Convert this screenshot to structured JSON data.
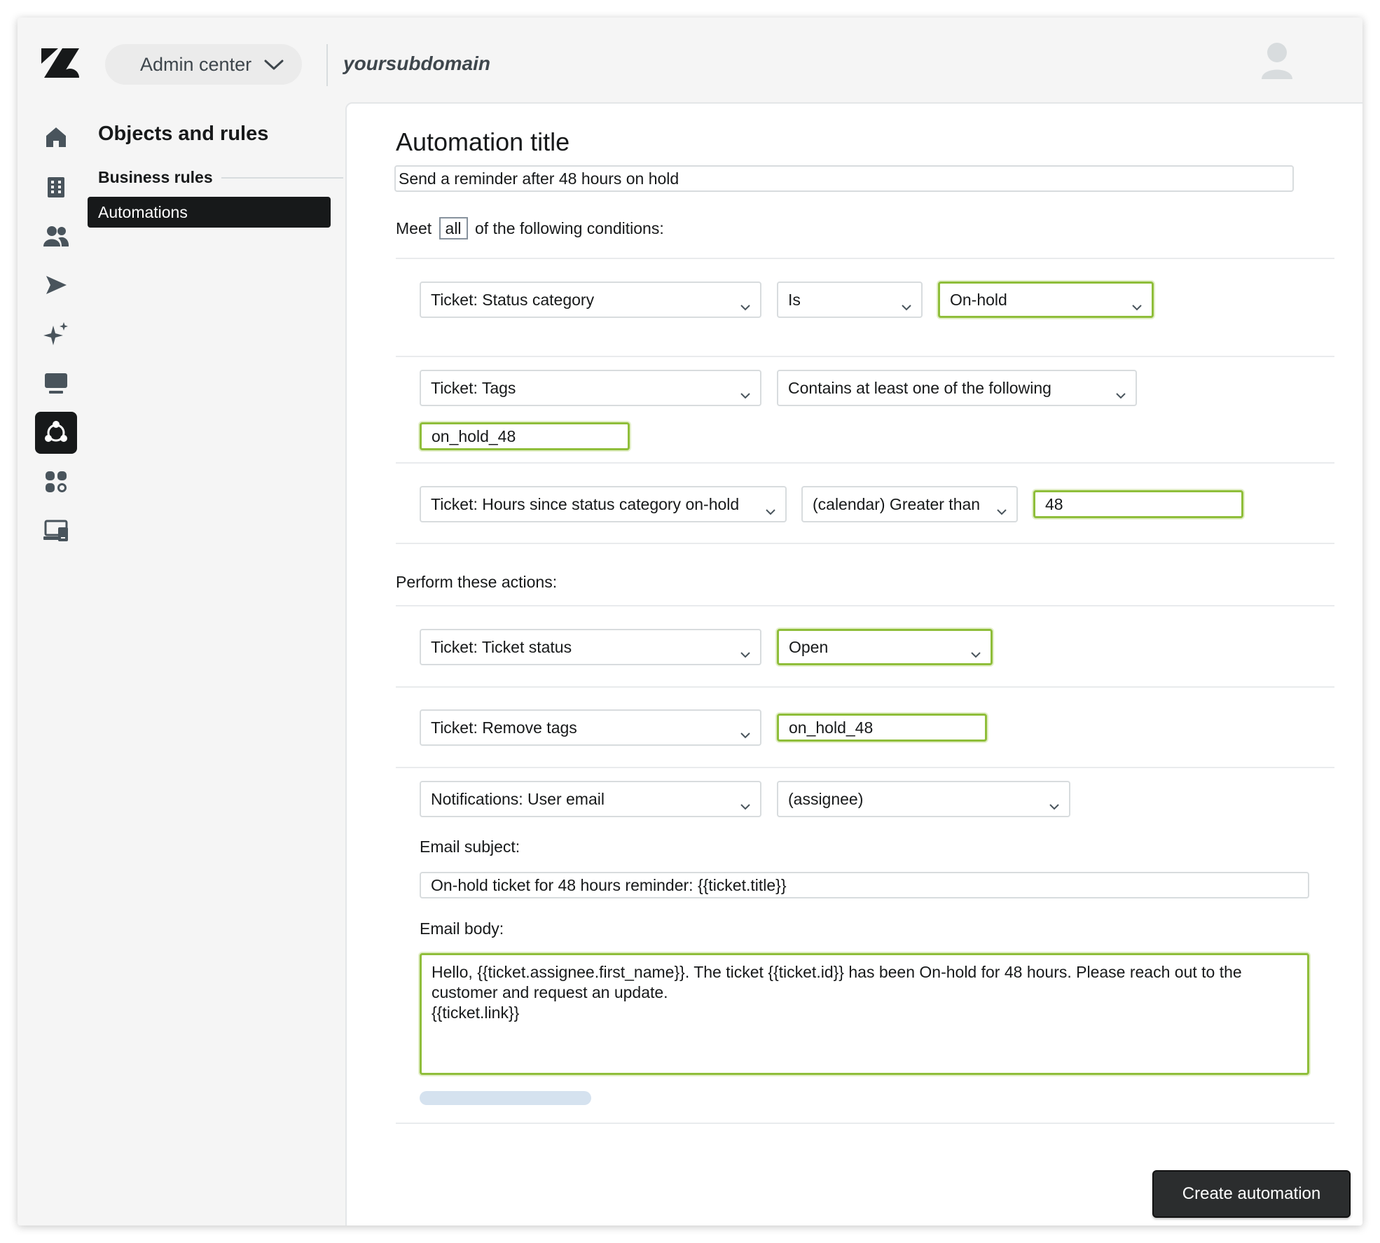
{
  "header": {
    "product_switcher_label": "Admin center",
    "subdomain": "yoursubdomain"
  },
  "icons": {
    "logo": "zendesk-logo-icon",
    "avatar": "user-avatar-icon",
    "nav": [
      "home-icon",
      "building-icon",
      "people-icon",
      "send-icon",
      "sparkle-icon",
      "monitor-icon",
      "objects-rules-icon",
      "apps-icon",
      "devices-icon"
    ]
  },
  "secondary_nav": {
    "title": "Objects and rules",
    "group_label": "Business rules",
    "selected_item": "Automations"
  },
  "form": {
    "title_label": "Automation title",
    "title_value": "Send a reminder after 48 hours on hold",
    "conditions_prefix": "Meet",
    "conditions_match": "all",
    "conditions_suffix": "of the following conditions:",
    "conditions": [
      {
        "field": "Ticket: Status category",
        "operator": "Is",
        "value": "On-hold"
      },
      {
        "field": "Ticket: Tags",
        "operator": "Contains at least one of the following",
        "value": "on_hold_48"
      },
      {
        "field": "Ticket: Hours since status category on-hold",
        "operator": "(calendar) Greater than",
        "value": "48"
      }
    ],
    "actions_label": "Perform these actions:",
    "actions": [
      {
        "field": "Ticket: Ticket status",
        "value": "Open"
      },
      {
        "field": "Ticket: Remove tags",
        "value": "on_hold_48"
      },
      {
        "field": "Notifications: User email",
        "value": "(assignee)"
      }
    ],
    "email_subject_label": "Email subject:",
    "email_subject_value": "On-hold ticket for 48 hours reminder: {{ticket.title}}",
    "email_body_label": "Email body:",
    "email_body_value": "Hello, {{ticket.assignee.first_name}}. The ticket {{ticket.id}} has been On-hold for 48 hours. Please reach out to the customer and request an update.\n{{ticket.link}}",
    "submit_label": "Create automation"
  },
  "colors": {
    "highlight_border": "#8fbe3a",
    "active_nav": "#17191a",
    "primary_button": "#2b2d2e"
  }
}
